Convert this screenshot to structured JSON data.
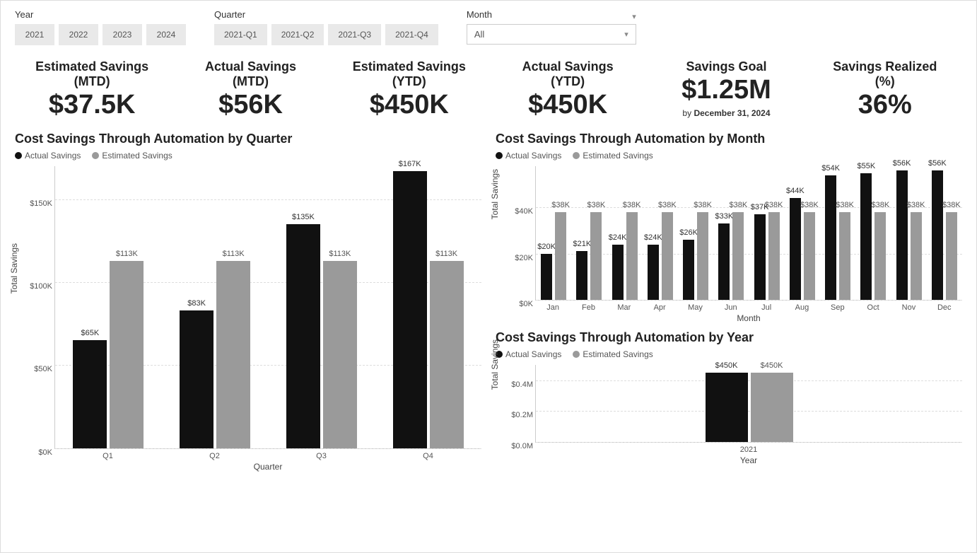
{
  "slicers": {
    "year": {
      "label": "Year",
      "options": [
        "2021",
        "2022",
        "2023",
        "2024"
      ]
    },
    "quarter": {
      "label": "Quarter",
      "options": [
        "2021-Q1",
        "2021-Q2",
        "2021-Q3",
        "2021-Q4"
      ]
    },
    "month": {
      "label": "Month",
      "selected": "All"
    }
  },
  "kpis": {
    "est_mtd": {
      "title": "Estimated Savings",
      "subtitle": "(MTD)",
      "value": "$37.5K"
    },
    "act_mtd": {
      "title": "Actual Savings",
      "subtitle": "(MTD)",
      "value": "$56K"
    },
    "est_ytd": {
      "title": "Estimated Savings",
      "subtitle": "(YTD)",
      "value": "$450K"
    },
    "act_ytd": {
      "title": "Actual Savings",
      "subtitle": "(YTD)",
      "value": "$450K"
    },
    "goal": {
      "title": "Savings Goal",
      "value": "$1.25M",
      "note_prefix": "by",
      "note": "December 31, 2024"
    },
    "realized": {
      "title": "Savings Realized",
      "subtitle": "(%)",
      "value": "36%"
    }
  },
  "legend": {
    "actual": "Actual Savings",
    "estimated": "Estimated Savings"
  },
  "axis_labels": {
    "total_savings": "Total Savings",
    "quarter": "Quarter",
    "month": "Month",
    "year": "Year"
  },
  "chart_data": [
    {
      "id": "quarter",
      "type": "bar",
      "title": "Cost Savings Through Automation by Quarter",
      "xlabel": "Quarter",
      "ylabel": "Total Savings",
      "ylim": [
        0,
        170000
      ],
      "yticks": [
        {
          "v": 0,
          "l": "$0K"
        },
        {
          "v": 50000,
          "l": "$50K"
        },
        {
          "v": 100000,
          "l": "$100K"
        },
        {
          "v": 150000,
          "l": "$150K"
        }
      ],
      "categories": [
        "Q1",
        "Q2",
        "Q3",
        "Q4"
      ],
      "series": [
        {
          "name": "Actual Savings",
          "color": "#111111",
          "values": [
            65000,
            83000,
            135000,
            167000
          ],
          "labels": [
            "$65K",
            "$83K",
            "$135K",
            "$167K"
          ]
        },
        {
          "name": "Estimated Savings",
          "color": "#9a9a9a",
          "values": [
            113000,
            113000,
            113000,
            113000
          ],
          "labels": [
            "$113K",
            "$113K",
            "$113K",
            "$113K"
          ]
        }
      ]
    },
    {
      "id": "month",
      "type": "bar",
      "title": "Cost Savings Through Automation by Month",
      "xlabel": "Month",
      "ylabel": "Total Savings",
      "ylim": [
        0,
        58000
      ],
      "yticks": [
        {
          "v": 0,
          "l": "$0K"
        },
        {
          "v": 20000,
          "l": "$20K"
        },
        {
          "v": 40000,
          "l": "$40K"
        }
      ],
      "categories": [
        "Jan",
        "Feb",
        "Mar",
        "Apr",
        "May",
        "Jun",
        "Jul",
        "Aug",
        "Sep",
        "Oct",
        "Nov",
        "Dec"
      ],
      "series": [
        {
          "name": "Actual Savings",
          "color": "#111111",
          "values": [
            20000,
            21000,
            24000,
            24000,
            26000,
            33000,
            37000,
            44000,
            54000,
            55000,
            56000,
            56000
          ],
          "labels": [
            "$20K",
            "$21K",
            "$24K",
            "$24K",
            "$26K",
            "$33K",
            "$37K",
            "$44K",
            "$54K",
            "$55K",
            "$56K",
            "$56K"
          ]
        },
        {
          "name": "Estimated Savings",
          "color": "#9a9a9a",
          "values": [
            38000,
            38000,
            38000,
            38000,
            38000,
            38000,
            38000,
            38000,
            38000,
            38000,
            38000,
            38000
          ],
          "labels": [
            "$38K",
            "$38K",
            "$38K",
            "$38K",
            "$38K",
            "$38K",
            "$38K",
            "$38K",
            "$38K",
            "$38K",
            "$38K",
            "$38K"
          ]
        }
      ]
    },
    {
      "id": "year",
      "type": "bar",
      "title": "Cost Savings Through Automation by Year",
      "xlabel": "Year",
      "ylabel": "Total Savings",
      "ylim": [
        0,
        500000
      ],
      "yticks": [
        {
          "v": 0,
          "l": "$0.0M"
        },
        {
          "v": 200000,
          "l": "$0.2M"
        },
        {
          "v": 400000,
          "l": "$0.4M"
        }
      ],
      "categories": [
        "2021"
      ],
      "series": [
        {
          "name": "Actual Savings",
          "color": "#111111",
          "values": [
            450000
          ],
          "labels": [
            "$450K"
          ]
        },
        {
          "name": "Estimated Savings",
          "color": "#9a9a9a",
          "values": [
            450000
          ],
          "labels": [
            "$450K"
          ]
        }
      ]
    }
  ]
}
